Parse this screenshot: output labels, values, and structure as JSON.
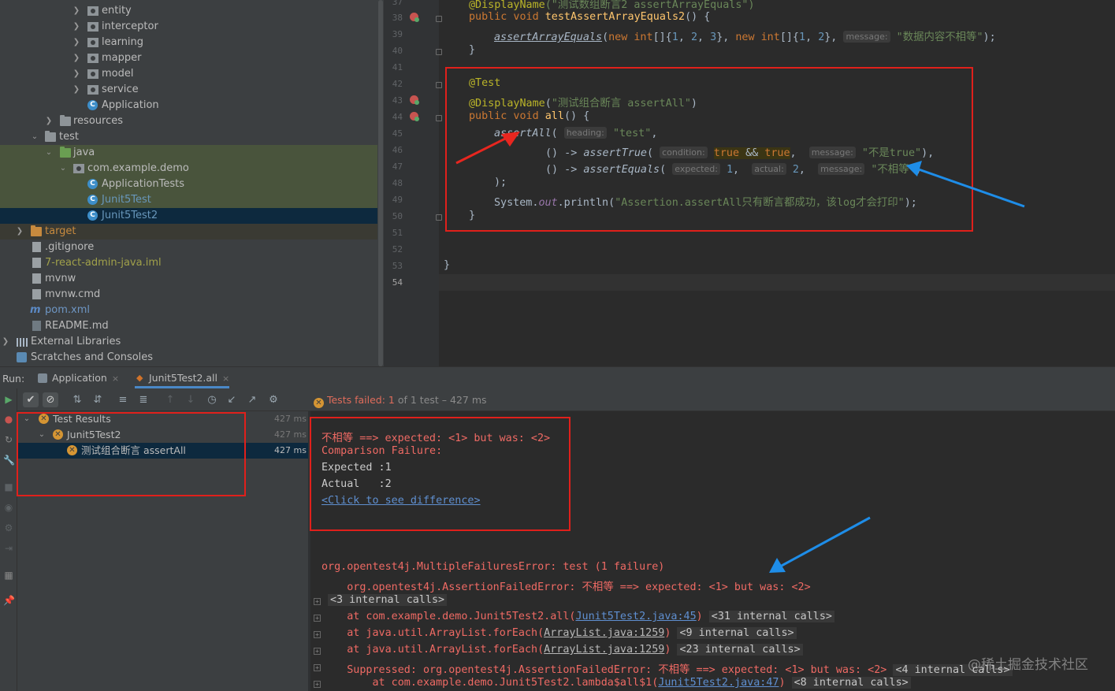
{
  "project_tree": {
    "items": [
      {
        "label": "entity"
      },
      {
        "label": "interceptor"
      },
      {
        "label": "learning"
      },
      {
        "label": "mapper"
      },
      {
        "label": "model"
      },
      {
        "label": "service"
      },
      {
        "label": "Application"
      },
      {
        "label": "resources"
      },
      {
        "label": "test"
      },
      {
        "label": "java"
      },
      {
        "label": "com.example.demo"
      },
      {
        "label": "ApplicationTests"
      },
      {
        "label": "Junit5Test"
      },
      {
        "label": "Junit5Test2"
      },
      {
        "label": "target"
      },
      {
        "label": ".gitignore"
      },
      {
        "label": "7-react-admin-java.iml"
      },
      {
        "label": "mvnw"
      },
      {
        "label": "mvnw.cmd"
      },
      {
        "label": "pom.xml"
      },
      {
        "label": "README.md"
      },
      {
        "label": "External Libraries"
      },
      {
        "label": "Scratches and Consoles"
      }
    ]
  },
  "editor": {
    "line_numbers": [
      "37",
      "38",
      "39",
      "40",
      "41",
      "42",
      "43",
      "44",
      "45",
      "46",
      "47",
      "48",
      "49",
      "50",
      "51",
      "52",
      "53",
      "54"
    ],
    "code": {
      "l37_ann": "@DisplayName",
      "l37_str": "(\"测试数组断言2 assertArrayEquals\")",
      "l38_kw": "public void ",
      "l38_fn": "testAssertArrayEquals2",
      "l38_rest": "() {",
      "l39_call": "assertArrayEquals",
      "l39_a": "(",
      "l39_new1": "new int",
      "l39_b": "[]{",
      "l39_n1": "1",
      "l39_c": ", ",
      "l39_n2": "2",
      "l39_d": ", ",
      "l39_n3": "3",
      "l39_e": "}, ",
      "l39_new2": "new int",
      "l39_f": "[]{",
      "l39_n4": "1",
      "l39_g": ", ",
      "l39_n5": "2",
      "l39_h": "}, ",
      "l39_hint": "message:",
      "l39_str": "\"数据内容不相等\"",
      "l39_end": ");",
      "l40": "}",
      "l42_ann": "@Test",
      "l43_ann": "@DisplayName",
      "l43_a": "(",
      "l43_str": "\"测试组合断言 assertAll\"",
      "l43_b": ")",
      "l44_kw": "public void ",
      "l44_fn": "all",
      "l44_rest": "() {",
      "l45_call": "assertAll",
      "l45_a": "( ",
      "l45_hint": "heading:",
      "l45_str": "\"test\"",
      "l45_b": ",",
      "l46_a": "() -> ",
      "l46_call": "assertTrue",
      "l46_b": "( ",
      "l46_hint1": "condition:",
      "l46_t1": "true",
      "l46_and": " && ",
      "l46_t2": "true",
      "l46_c": ",  ",
      "l46_hint2": "message:",
      "l46_str": "\"不是true\"",
      "l46_d": "),",
      "l47_a": "() -> ",
      "l47_call": "assertEquals",
      "l47_b": "( ",
      "l47_hint1": "expected:",
      "l47_n1": "1",
      "l47_c": ",  ",
      "l47_hint2": "actual:",
      "l47_n2": "2",
      "l47_d": ",  ",
      "l47_hint3": "message:",
      "l47_str": "\"不相等\"",
      "l47_e": ")",
      "l48": ");",
      "l49_a": "System.",
      "l49_out": "out",
      "l49_b": ".println(",
      "l49_str": "\"Assertion.assertAll只有断言都成功，该log才会打印\"",
      "l49_c": ");",
      "l50": "}",
      "l53": "}"
    }
  },
  "run": {
    "label": "Run:",
    "tabs": [
      {
        "label": "Application",
        "close": "×"
      },
      {
        "label": "Junit5Test2.all",
        "close": "×"
      }
    ],
    "status_failed": "Tests failed:",
    "status_count": "1",
    "status_rest": "of 1 test – 427 ms",
    "tree": {
      "root": {
        "label": "Test Results",
        "time": "427 ms"
      },
      "class": {
        "label": "Junit5Test2",
        "time": "427 ms"
      },
      "method": {
        "label": "测试组合断言 assertAll",
        "time": "427 ms"
      }
    }
  },
  "console": {
    "l1": "不相等 ==> expected: <1> but was: <2>",
    "l2": "Comparison Failure:",
    "l3": "Expected :1",
    "l4": "Actual   :2",
    "l5_link": "<Click to see difference>",
    "l6": "org.opentest4j.MultipleFailuresError: test (1 failure)",
    "l7": "    org.opentest4j.AssertionFailedError: 不相等 ==> expected: <1> but was: <2>",
    "l8": "<3 internal calls>",
    "l9_a": "    at com.example.demo.Junit5Test2.all(",
    "l9_link": "Junit5Test2.java:45",
    "l9_b": ")",
    "l9_chip": "<31 internal calls>",
    "l10_a": "    at java.util.ArrayList.forEach(",
    "l10_link": "ArrayList.java:1259",
    "l10_b": ")",
    "l10_chip": "<9 internal calls>",
    "l11_a": "    at java.util.ArrayList.forEach(",
    "l11_link": "ArrayList.java:1259",
    "l11_b": ")",
    "l11_chip": "<23 internal calls>",
    "l12_a": "    Suppressed: org.opentest4j.AssertionFailedError: 不相等 ==> expected: <1> but was: <2>",
    "l12_chip": "<4 internal calls>",
    "l13_a": "        at com.example.demo.Junit5Test2.lambda$all$1(",
    "l13_link": "Junit5Test2.java:47",
    "l13_b": ")",
    "l13_chip": "<8 internal calls>"
  },
  "watermark": "@稀土掘金技术社区",
  "colors": {
    "highlight_box": "#e0201b",
    "red_arrow": "#e8261f",
    "blue_arrow": "#1e8de8"
  }
}
